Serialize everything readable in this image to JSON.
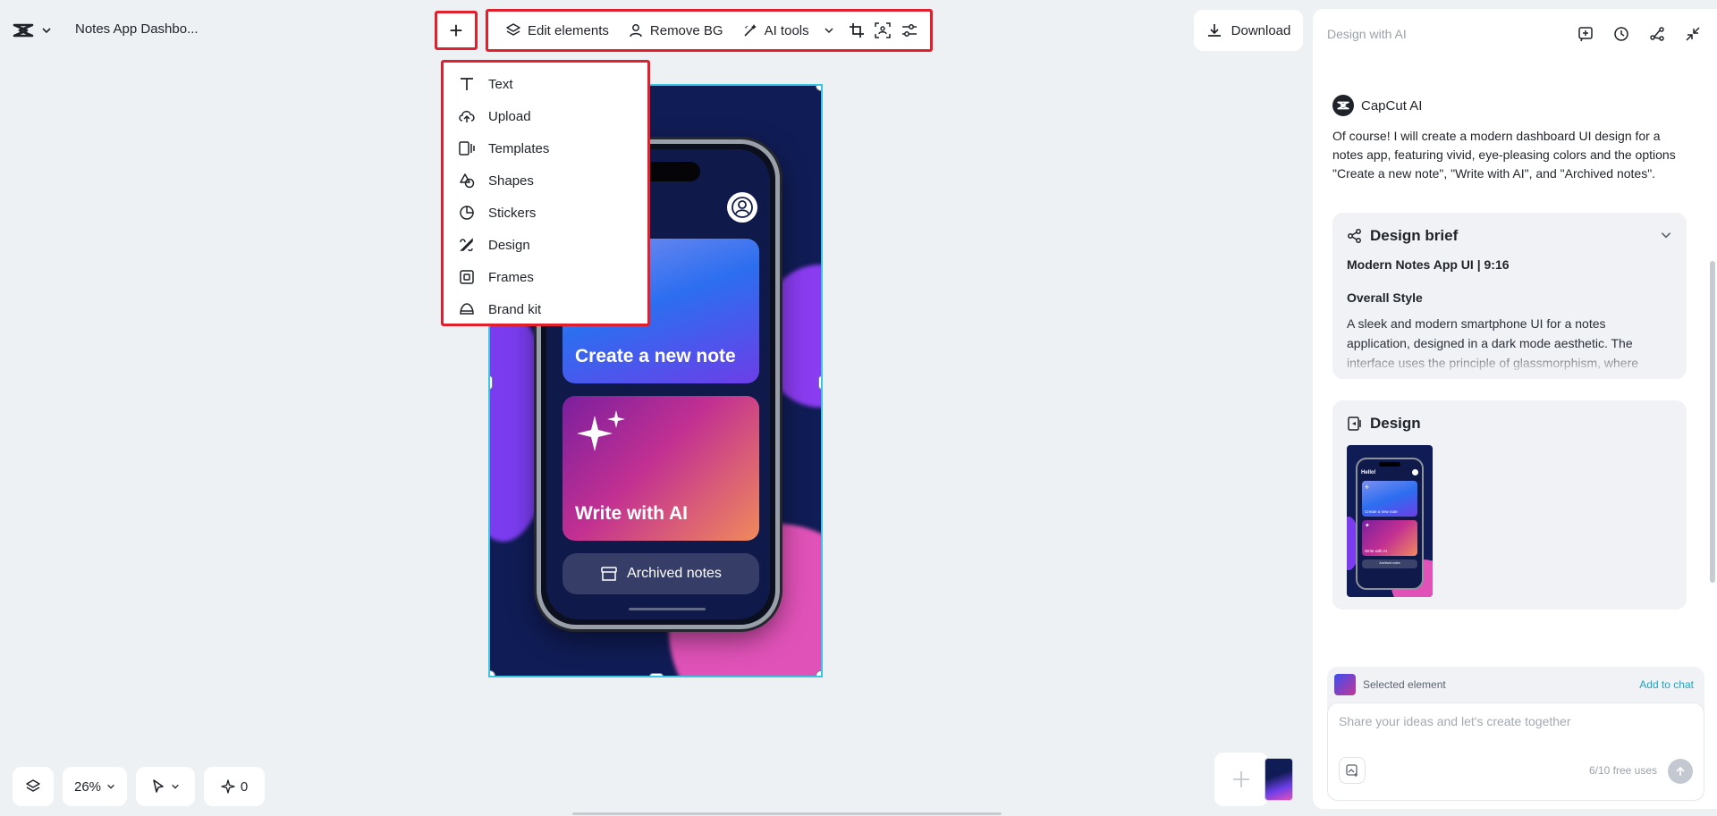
{
  "app": {
    "doc_title": "Notes App Dashbo..."
  },
  "toolbar": {
    "add_symbol": "+",
    "edit_elements": "Edit elements",
    "remove_bg": "Remove BG",
    "ai_tools": "AI tools",
    "download": "Download"
  },
  "add_menu": {
    "items": [
      {
        "label": "Text",
        "icon": "text-icon"
      },
      {
        "label": "Upload",
        "icon": "upload-cloud-icon"
      },
      {
        "label": "Templates",
        "icon": "templates-icon"
      },
      {
        "label": "Shapes",
        "icon": "shapes-icon"
      },
      {
        "label": "Stickers",
        "icon": "sticker-icon"
      },
      {
        "label": "Design",
        "icon": "design-icon"
      },
      {
        "label": "Frames",
        "icon": "frame-icon"
      },
      {
        "label": "Brand kit",
        "icon": "brand-kit-icon"
      }
    ]
  },
  "canvas": {
    "card1": "Create a new note",
    "card2": "Write with AI",
    "archived": "Archived notes",
    "accent_border": "#38c5e6",
    "highlight": "#e0202c"
  },
  "bottom_bar": {
    "zoom": "26%",
    "credits": "0"
  },
  "panel": {
    "title": "Design with AI",
    "ai_name": "CapCut AI",
    "message": "Of course! I will create a modern dashboard UI design for a notes app, featuring vivid, eye-pleasing colors and the options \"Create a new note\", \"Write with AI\", and \"Archived notes\".",
    "brief": {
      "heading": "Design brief",
      "subtitle": "Modern Notes App UI | 9:16",
      "style_heading": "Overall Style",
      "style_text": "A sleek and modern smartphone UI for a notes application, designed in a dark mode aesthetic. The interface uses the principle of glassmorphism, where"
    },
    "design": {
      "heading": "Design",
      "thumb_greeting": "Hello!",
      "thumb_card1": "Create a new note",
      "thumb_card2": "Write with AI",
      "thumb_archived": "Archived notes"
    },
    "composer": {
      "selected_label": "Selected element",
      "add_to_chat": "Add to chat",
      "placeholder": "Share your ideas and let's create together",
      "uses": "6/10 free uses"
    }
  }
}
